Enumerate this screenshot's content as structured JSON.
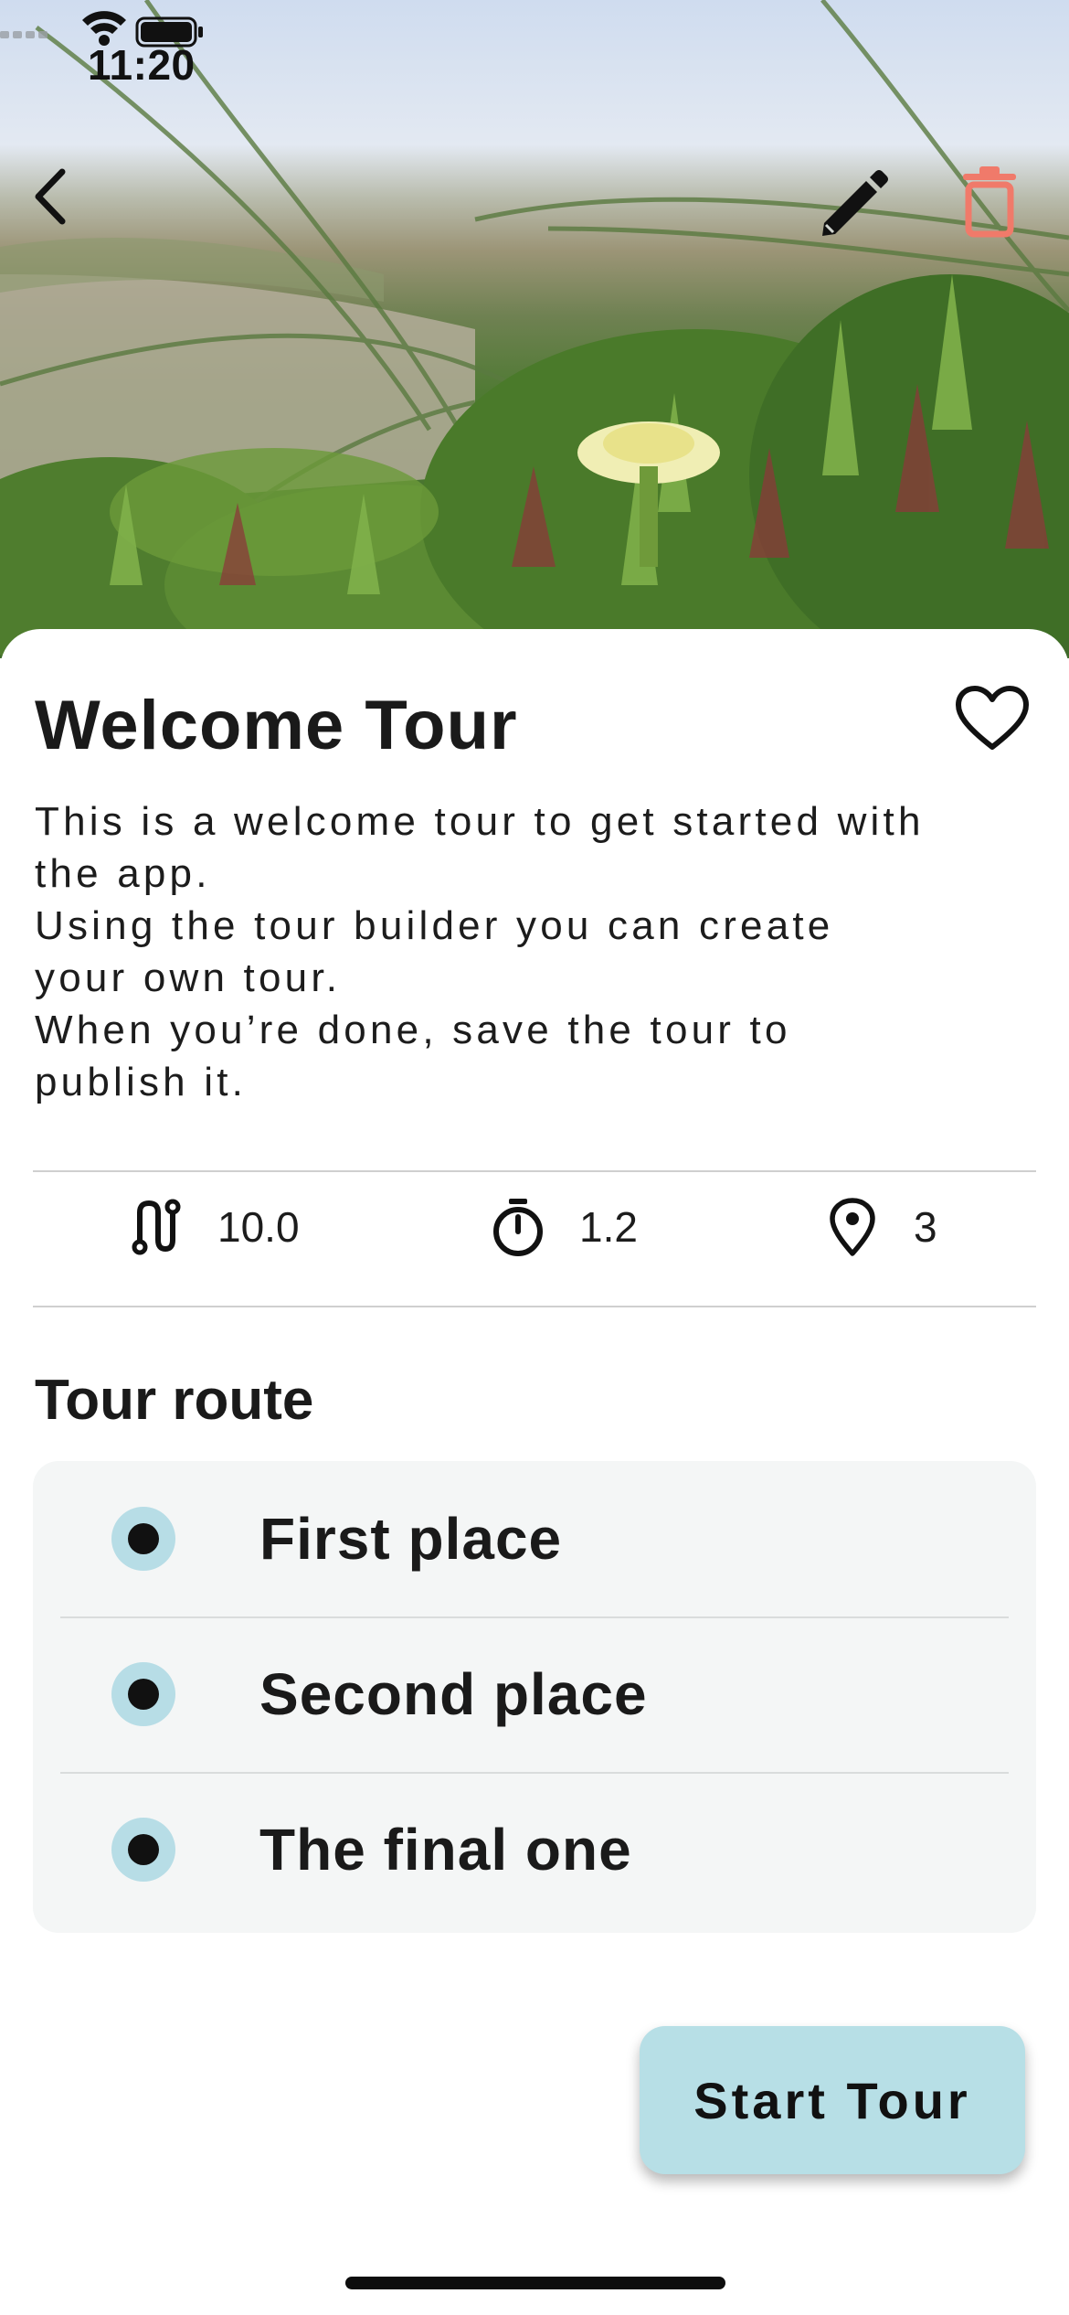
{
  "status_bar": {
    "time": "11:20"
  },
  "header": {
    "back_icon": "chevron-left-icon",
    "edit_icon": "pencil-icon",
    "delete_icon": "trash-icon",
    "delete_color": "#f07a6a"
  },
  "tour": {
    "title": "Welcome Tour",
    "favorite_icon": "heart-outline-icon",
    "description_lines": [
      "This is a welcome tour to get started with",
      "the app.",
      "Using the tour builder you can create",
      "your own tour.",
      "When you’re done, save the tour to",
      "publish it."
    ],
    "stats": [
      {
        "icon": "route-icon",
        "value": "10.0"
      },
      {
        "icon": "timer-icon",
        "value": "1.2"
      },
      {
        "icon": "location-pin-icon",
        "value": "3"
      }
    ]
  },
  "route": {
    "section_title": "Tour route",
    "items": [
      {
        "label": "First place"
      },
      {
        "label": "Second place"
      },
      {
        "label": "The final one"
      }
    ]
  },
  "actions": {
    "start_label": "Start Tour"
  },
  "colors": {
    "accent": "#b7dfe6",
    "card_bg": "#f4f6f6"
  }
}
